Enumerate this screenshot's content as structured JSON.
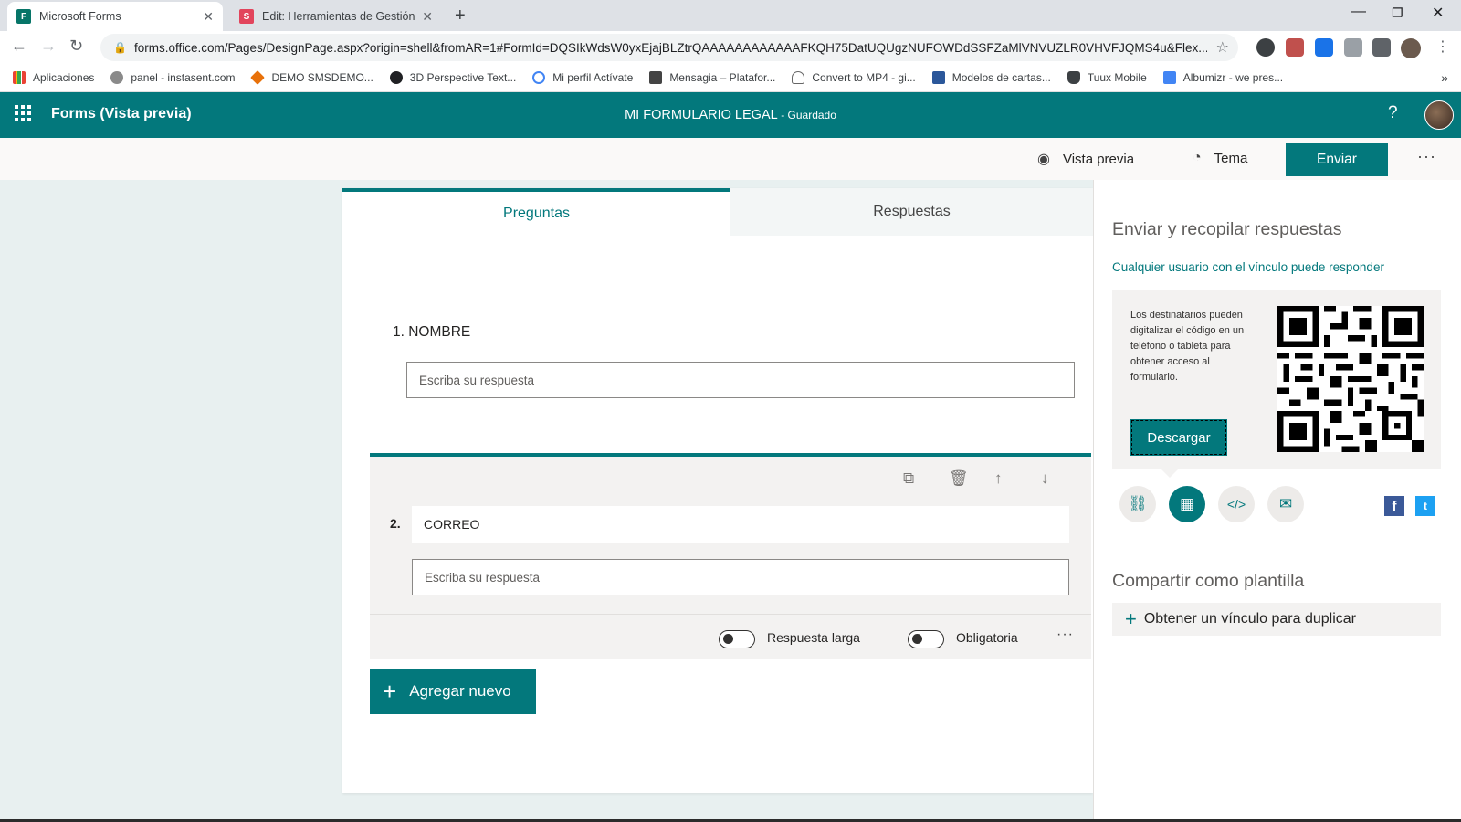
{
  "browser": {
    "tabs": [
      {
        "title": "Microsoft Forms",
        "favicon_color": "#077568"
      },
      {
        "title": "Edit: Herramientas de Gestión Di",
        "favicon_color": "#e2445c"
      }
    ],
    "url": "forms.office.com/Pages/DesignPage.aspx?origin=shell&fromAR=1#FormId=DQSIkWdsW0yxEjajBLZtrQAAAAAAAAAAAAFKQH75DatUQUgzNUFOWDdSSFZaMlVNVUZLR0VHVFJQMS4u&Flex...",
    "bookmarks": [
      "Aplicaciones",
      "panel - instasent.com",
      "DEMO SMSDEMO...",
      "3D Perspective Text...",
      "Mi perfil Actívate",
      "Mensagia – Platafor...",
      "Convert to MP4 - gi...",
      "Modelos de cartas...",
      "Tuux Mobile",
      "Albumizr - we pres..."
    ]
  },
  "app": {
    "name": "Forms (Vista previa)",
    "form_title": "MI FORMULARIO LEGAL",
    "status": "- Guardado",
    "help": "?"
  },
  "commands": {
    "preview": "Vista previa",
    "theme": "Tema",
    "send": "Enviar"
  },
  "form": {
    "tabs": {
      "questions": "Preguntas",
      "responses": "Respuestas"
    },
    "q1": {
      "label": "1. NOMBRE",
      "placeholder": "Escriba su respuesta"
    },
    "q2": {
      "number": "2.",
      "title": "CORREO",
      "placeholder": "Escriba su respuesta",
      "long_answer": "Respuesta larga",
      "required": "Obligatoria"
    },
    "add_new": "Agregar nuevo"
  },
  "panel": {
    "title": "Enviar y recopilar respuestas",
    "link_scope": "Cualquier usuario con el vínculo puede responder",
    "qr_text": "Los destinatarios pueden digitalizar el código en un teléfono o tableta para obtener acceso al formulario.",
    "download": "Descargar",
    "template_title": "Compartir como plantilla",
    "duplicate": "Obtener un vínculo para duplicar"
  },
  "colors": {
    "accent": "#03787c",
    "facebook": "#3b5998",
    "twitter": "#1da1f2"
  }
}
